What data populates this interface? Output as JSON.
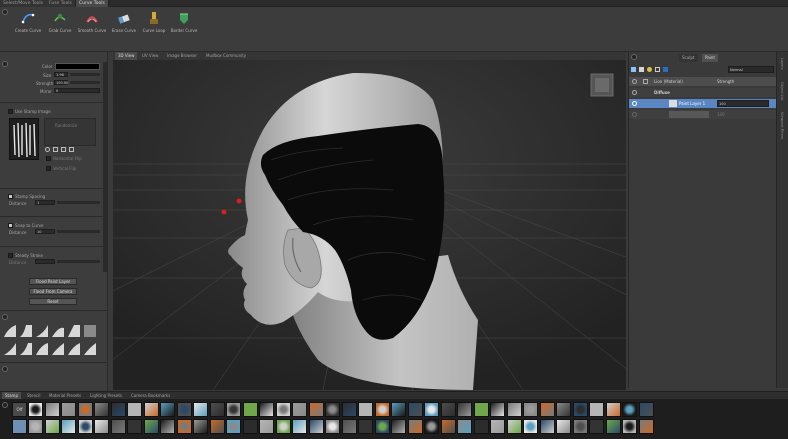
{
  "top_tabs": [
    "Select/Move Tools",
    "Fuse Tools",
    "Curve Tools"
  ],
  "active_top_tab": 2,
  "tools": [
    {
      "label": "Create Curve",
      "icon": "create-curve-icon"
    },
    {
      "label": "Grab Curve",
      "icon": "grab-curve-icon"
    },
    {
      "label": "Smooth Curve",
      "icon": "smooth-curve-icon"
    },
    {
      "label": "Erase Curve",
      "icon": "erase-curve-icon"
    },
    {
      "label": "Curve Loop",
      "icon": "curve-loop-icon"
    },
    {
      "label": "Border Curve",
      "icon": "border-curve-icon"
    }
  ],
  "left_panel": {
    "color_label": "Color",
    "size_label": "Size",
    "size_value": "1.96",
    "strength_label": "Strength",
    "strength_value": "100.00",
    "mirror_label": "Mirror",
    "mirror_value": "0",
    "use_stamp_image": "Use Stamp Image",
    "randomize": "Randomize",
    "horizontal_flip": "Horizontal Flip",
    "vertical_flip": "Vertical Flip",
    "stamp_spacing": "Stamp Spacing",
    "distance_label": "Distance",
    "distance_value": "1",
    "snap_to_curve": "Snap to Curve",
    "snap_distance_value": "10",
    "steady_stroke": "Steady Stroke",
    "steady_distance_label": "Distance",
    "btn_flood_paint": "Flood Paint Layer",
    "btn_flood_camera": "Flood From Camera",
    "btn_reset": "Reset"
  },
  "view_tabs": [
    "3D View",
    "UV View",
    "Image Browser",
    "Mudbox Community"
  ],
  "active_view_tab": 0,
  "right_panel": {
    "tabs": [
      "Sculpt",
      "Paint"
    ],
    "active_tab": 1,
    "blend_mode": "Normal",
    "material_label": "Lion (Material)",
    "channel_label": "Strength",
    "diffuse_label": "Diffuse",
    "layer1_name": "Paint Layer 1",
    "layer1_opacity": "100",
    "layer2_opacity": "100"
  },
  "right_strip_tabs": [
    "Layers",
    "Object List",
    "Viewport Filters"
  ],
  "shelf_tabs": [
    "Stamp",
    "Stencil",
    "Material Presets",
    "Lighting Presets",
    "Camera Bookmarks"
  ],
  "active_shelf_tab": 0,
  "shelf_first": "Off",
  "colors": {
    "accent_blue": "#5a86c4",
    "marker_red": "#e01e1e",
    "hair": "#0a0a0a",
    "skin": "#c9c9c9"
  }
}
